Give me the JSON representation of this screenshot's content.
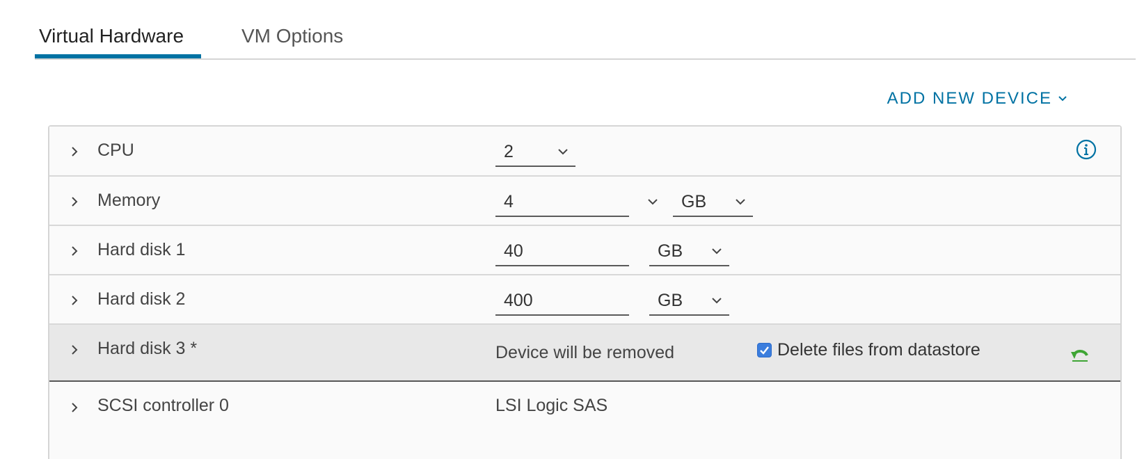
{
  "tabs": [
    {
      "label": "Virtual Hardware",
      "active": true
    },
    {
      "label": "VM Options",
      "active": false
    }
  ],
  "add_device": {
    "label": "ADD NEW DEVICE",
    "icon": "chevron-down-icon"
  },
  "colors": {
    "accent": "#0072a3",
    "checkbox": "#3b7ddd",
    "undo": "#3fa535",
    "removed_row_bg": "#e8e8e8"
  },
  "devices": {
    "cpu": {
      "label": "CPU",
      "value": "2",
      "icon": "info-icon"
    },
    "memory": {
      "label": "Memory",
      "value": "4",
      "unit": "GB"
    },
    "disk1": {
      "label": "Hard disk 1",
      "value": "40",
      "unit": "GB"
    },
    "disk2": {
      "label": "Hard disk 2",
      "value": "400",
      "unit": "GB"
    },
    "disk3": {
      "label": "Hard disk 3 *",
      "status": "Device will be removed",
      "delete_files_label": "Delete files from datastore",
      "delete_files_checked": true,
      "icon": "undo-icon"
    },
    "scsi": {
      "label": "SCSI controller 0",
      "value": "LSI Logic SAS"
    }
  }
}
